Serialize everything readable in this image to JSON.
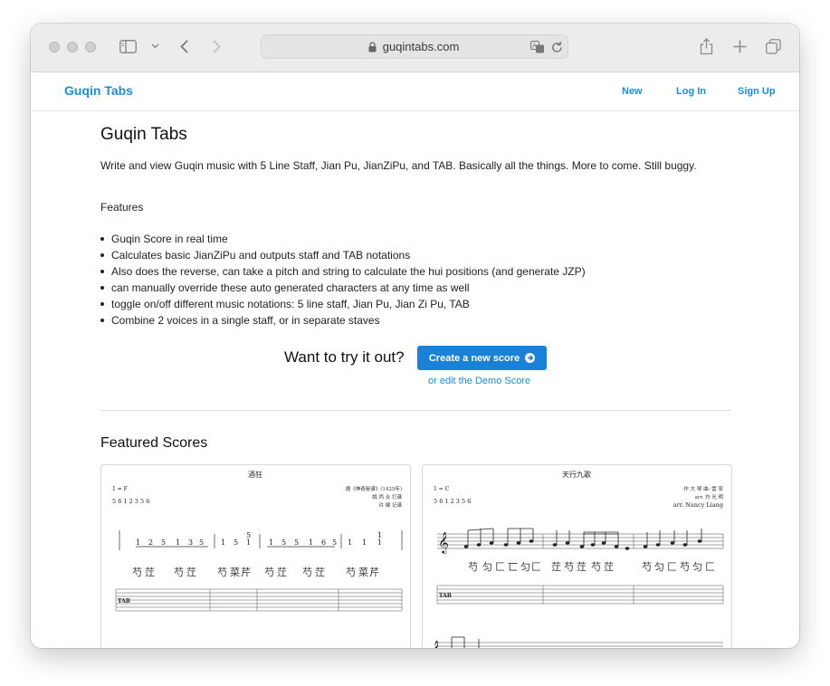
{
  "browser": {
    "url": "guqintabs.com"
  },
  "nav": {
    "brand": "Guqin Tabs",
    "links": [
      "New",
      "Log In",
      "Sign Up"
    ]
  },
  "main": {
    "title": "Guqin Tabs",
    "intro": "Write and view Guqin music with 5 Line Staff, Jian Pu, JianZiPu, and TAB. Basically all the things. More to come. Still buggy.",
    "features_heading": "Features",
    "features": [
      "Guqin Score in real time",
      "Calculates basic JianZiPu and outputs staff and TAB notations",
      "Also does the reverse, can take a pitch and string to calculate the hui positions (and generate JZP)",
      "can manually override these auto generated characters at any time as well",
      "toggle on/off different music notations: 5 line staff, Jian Pu, Jian Zi Pu, TAB",
      "Combine 2 voices in a single staff, or in separate staves"
    ],
    "cta_text": "Want to try it out?",
    "cta_button": "Create a new score",
    "demo_link": "or edit the Demo Score",
    "featured_heading": "Featured Scores"
  },
  "scores": [
    {
      "title": "酒狂",
      "key": "1 = F",
      "tuning": "5 6 1 2 3 5 6",
      "credit_lines": [
        "据《神奇秘谱》(1425年)",
        "姚 丙 炎 打谱",
        "许 健 记谱"
      ]
    },
    {
      "title": "天行九歌",
      "key": "1 = C",
      "tuning": "5 6 1 2 3 5 6",
      "credit_lines": [
        "作 大 琴 曲: 雲 寧",
        "arr. 白 光 明",
        "arr. Nancy Liang"
      ]
    }
  ]
}
